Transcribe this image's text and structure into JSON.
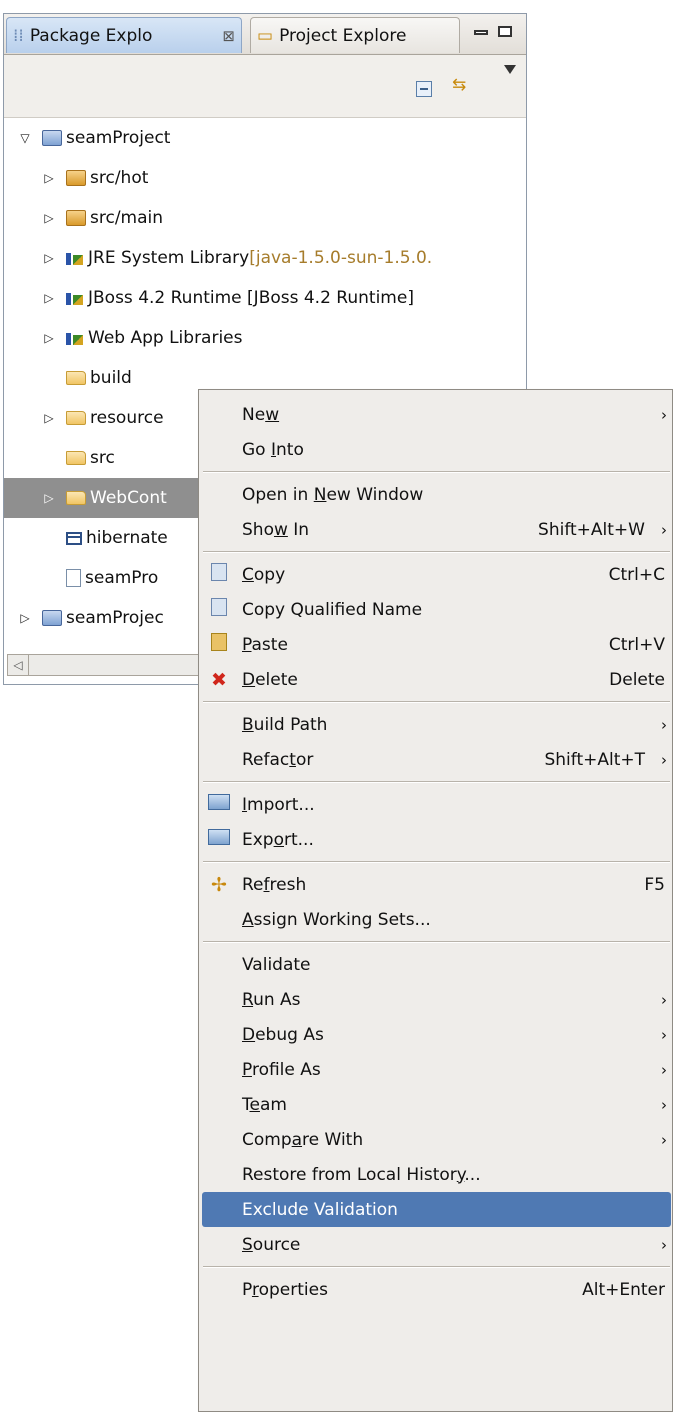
{
  "tabs": [
    {
      "label": "Package Explo",
      "close": "⊠"
    },
    {
      "label": "Project Explore"
    }
  ],
  "tree": [
    {
      "label": "seamProject",
      "twisty": "▽",
      "icon": "project",
      "indent": 0
    },
    {
      "label": "src/hot",
      "twisty": "▷",
      "icon": "package-folder",
      "indent": 1
    },
    {
      "label": "src/main",
      "twisty": "▷",
      "icon": "package-folder",
      "indent": 1
    },
    {
      "label": "JRE System Library",
      "suffix": "[java-1.5.0-sun-1.5.0.",
      "twisty": "▷",
      "icon": "library",
      "indent": 1
    },
    {
      "label": "JBoss 4.2 Runtime [JBoss 4.2 Runtime]",
      "twisty": "▷",
      "icon": "library",
      "indent": 1
    },
    {
      "label": "Web App Libraries",
      "twisty": "▷",
      "icon": "library",
      "indent": 1
    },
    {
      "label": "build",
      "twisty": "",
      "icon": "folder",
      "indent": 1
    },
    {
      "label": "resource",
      "twisty": "▷",
      "icon": "folder",
      "indent": 1
    },
    {
      "label": "src",
      "twisty": "",
      "icon": "folder",
      "indent": 1
    },
    {
      "label": "WebCont",
      "twisty": "▷",
      "icon": "folder",
      "indent": 1,
      "selected": true
    },
    {
      "label": "hibernate",
      "twisty": "",
      "icon": "table",
      "indent": 1
    },
    {
      "label": "seamPro",
      "twisty": "",
      "icon": "file",
      "indent": 1
    },
    {
      "label": "seamProjec",
      "twisty": "▷",
      "icon": "project",
      "indent": 0
    }
  ],
  "menu": [
    {
      "pre": "Ne",
      "mn": "w",
      "post": "",
      "shortcut": "",
      "submenu": true
    },
    {
      "pre": "Go ",
      "mn": "I",
      "post": "nto",
      "shortcut": ""
    },
    {
      "sep": true
    },
    {
      "pre": "Open in ",
      "mn": "N",
      "post": "ew Window",
      "shortcut": ""
    },
    {
      "pre": "Sho",
      "mn": "w",
      "post": " In",
      "shortcut": "Shift+Alt+W",
      "submenu": true
    },
    {
      "sep": true
    },
    {
      "pre": "",
      "mn": "C",
      "post": "opy",
      "shortcut": "Ctrl+C",
      "icon": "copy"
    },
    {
      "pre": "Copy Qualified Name",
      "mn": "",
      "post": "",
      "shortcut": "",
      "icon": "copy-qualified"
    },
    {
      "pre": "",
      "mn": "P",
      "post": "aste",
      "shortcut": "Ctrl+V",
      "icon": "paste"
    },
    {
      "pre": "",
      "mn": "D",
      "post": "elete",
      "shortcut": "Delete",
      "icon": "delete"
    },
    {
      "sep": true
    },
    {
      "pre": "",
      "mn": "B",
      "post": "uild Path",
      "shortcut": "",
      "submenu": true
    },
    {
      "pre": "Refac",
      "mn": "t",
      "post": "or",
      "shortcut": "Shift+Alt+T",
      "submenu": true
    },
    {
      "sep": true
    },
    {
      "pre": "",
      "mn": "I",
      "post": "mport...",
      "shortcut": "",
      "icon": "import"
    },
    {
      "pre": "Exp",
      "mn": "o",
      "post": "rt...",
      "shortcut": "",
      "icon": "export"
    },
    {
      "sep": true
    },
    {
      "pre": "Re",
      "mn": "f",
      "post": "resh",
      "shortcut": "F5",
      "icon": "refresh"
    },
    {
      "pre": "",
      "mn": "A",
      "post": "ssign Working Sets...",
      "shortcut": ""
    },
    {
      "sep": true
    },
    {
      "pre": "Validate",
      "mn": "",
      "post": "",
      "shortcut": ""
    },
    {
      "pre": "",
      "mn": "R",
      "post": "un As",
      "shortcut": "",
      "submenu": true
    },
    {
      "pre": "",
      "mn": "D",
      "post": "ebug As",
      "shortcut": "",
      "submenu": true
    },
    {
      "pre": "",
      "mn": "P",
      "post": "rofile As",
      "shortcut": "",
      "submenu": true
    },
    {
      "pre": "T",
      "mn": "e",
      "post": "am",
      "shortcut": "",
      "submenu": true
    },
    {
      "pre": "Comp",
      "mn": "a",
      "post": "re With",
      "shortcut": "",
      "submenu": true
    },
    {
      "pre": "Restore from Local Histor",
      "mn": "y",
      "post": "...",
      "shortcut": ""
    },
    {
      "pre": "Exclude Validation",
      "mn": "",
      "post": "",
      "shortcut": "",
      "highlighted": true
    },
    {
      "pre": "",
      "mn": "S",
      "post": "ource",
      "shortcut": "",
      "submenu": true
    },
    {
      "sep": true
    },
    {
      "pre": "P",
      "mn": "r",
      "post": "operties",
      "shortcut": "Alt+Enter"
    }
  ],
  "colors": {
    "highlight": "#4f79b3",
    "selection": "#8f8f8f",
    "menu_bg": "#efedea"
  }
}
